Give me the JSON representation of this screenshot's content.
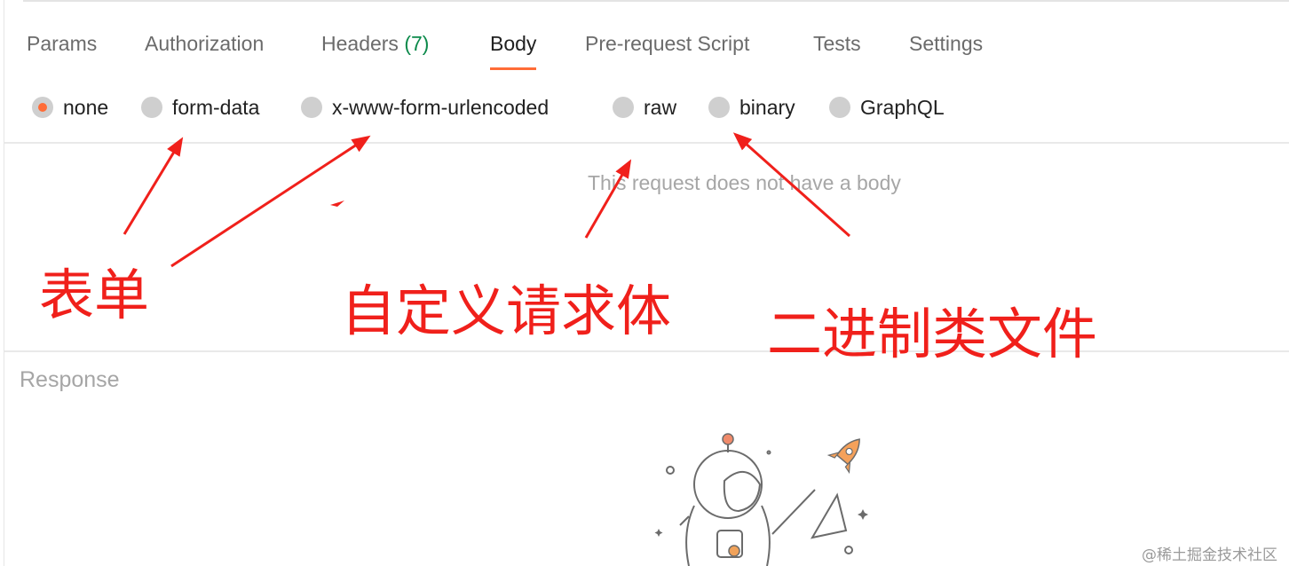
{
  "tabs": [
    {
      "label": "Params"
    },
    {
      "label": "Authorization"
    },
    {
      "label": "Headers",
      "count": "(7)"
    },
    {
      "label": "Body",
      "active": true
    },
    {
      "label": "Pre-request Script"
    },
    {
      "label": "Tests"
    },
    {
      "label": "Settings"
    }
  ],
  "body_types": {
    "selected": "none",
    "options": [
      "none",
      "form-data",
      "x-www-form-urlencoded",
      "raw",
      "binary",
      "GraphQL"
    ]
  },
  "body_empty_message": "This request does not have a body",
  "response": {
    "title": "Response"
  },
  "annotations": {
    "form": "表单",
    "custom_body": "自定义请求体",
    "binary_file": "二进制类文件"
  },
  "colors": {
    "accent": "#ff6c37",
    "count_green": "#0c8a4b",
    "annotation_red": "#f0201b"
  },
  "watermark": "@稀土掘金技术社区"
}
